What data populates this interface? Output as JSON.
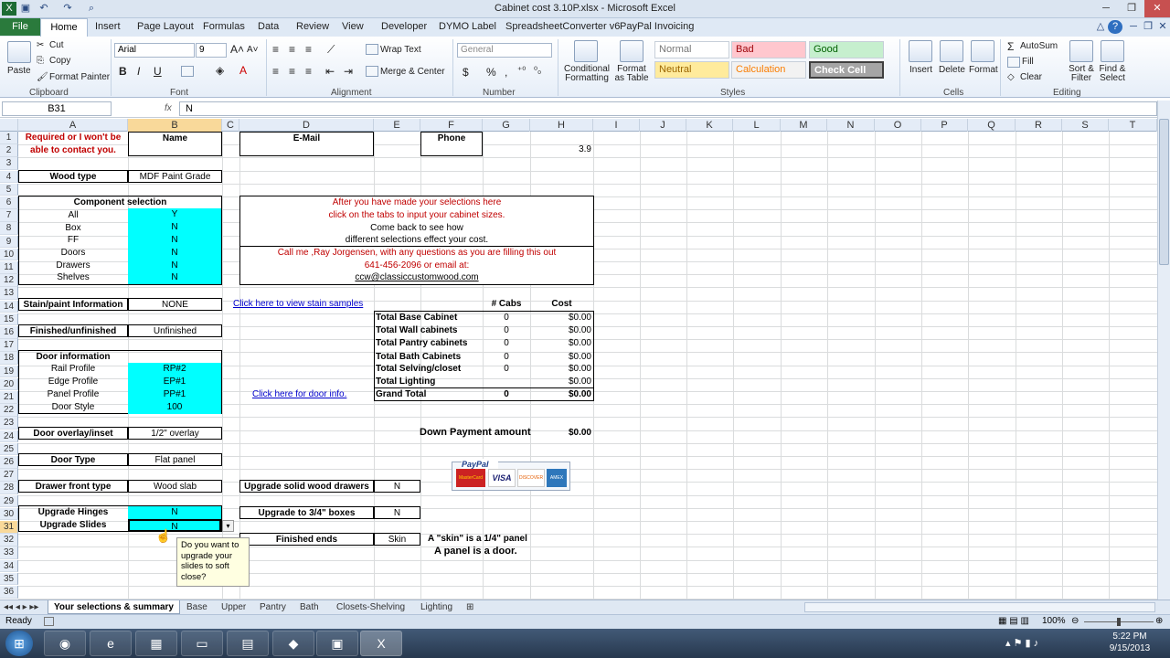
{
  "window": {
    "title": "Cabinet cost 3.10P.xlsx - Microsoft Excel"
  },
  "ribbon_tabs": [
    "File",
    "Home",
    "Insert",
    "Page Layout",
    "Formulas",
    "Data",
    "Review",
    "View",
    "Developer",
    "DYMO Label",
    "SpreadsheetConverter v6",
    "PayPal Invoicing"
  ],
  "clipboard": {
    "paste": "Paste",
    "cut": "Cut",
    "copy": "Copy",
    "format_painter": "Format Painter",
    "label": "Clipboard"
  },
  "font": {
    "name": "Arial",
    "size": "9",
    "label": "Font"
  },
  "alignment": {
    "wrap": "Wrap Text",
    "merge": "Merge & Center",
    "label": "Alignment"
  },
  "number": {
    "format": "General",
    "label": "Number",
    "currency": "$",
    "percent": "%",
    "comma": ","
  },
  "styles": {
    "conditional": "Conditional Formatting",
    "format_table": "Format as Table",
    "normal": "Normal",
    "bad": "Bad",
    "good": "Good",
    "neutral": "Neutral",
    "calculation": "Calculation",
    "check_cell": "Check Cell",
    "label": "Styles"
  },
  "cells_group": {
    "insert": "Insert",
    "delete": "Delete",
    "format": "Format",
    "label": "Cells"
  },
  "editing": {
    "autosum": "AutoSum",
    "fill": "Fill",
    "clear": "Clear",
    "sort": "Sort & Filter",
    "find": "Find & Select",
    "label": "Editing"
  },
  "formula_bar": {
    "name_box": "B31",
    "fx": "fx",
    "content": "N"
  },
  "columns": [
    "A",
    "B",
    "C",
    "D",
    "E",
    "F",
    "G",
    "H",
    "I",
    "J",
    "K",
    "L",
    "M",
    "N",
    "O",
    "P",
    "Q",
    "R",
    "S",
    "T"
  ],
  "rows": [
    "1",
    "2",
    "3",
    "4",
    "5",
    "6",
    "7",
    "8",
    "9",
    "10",
    "11",
    "12",
    "13",
    "14",
    "15",
    "16",
    "17",
    "18",
    "19",
    "20",
    "21",
    "22",
    "23",
    "24",
    "25",
    "26",
    "27",
    "28",
    "29",
    "30",
    "31",
    "32",
    "33",
    "34",
    "35",
    "36"
  ],
  "sheet": {
    "required_1": "Required or I won't be",
    "required_2": "able to contact you.",
    "name_hdr": "Name",
    "email_hdr": "E-Mail",
    "phone_hdr": "Phone",
    "h2": "3.9",
    "wood_type_lbl": "Wood type",
    "wood_type_val": "MDF Paint Grade",
    "component_hdr": "Component selection",
    "components": [
      {
        "label": "All",
        "val": "Y"
      },
      {
        "label": "Box",
        "val": "N"
      },
      {
        "label": "FF",
        "val": "N"
      },
      {
        "label": "Doors",
        "val": "N"
      },
      {
        "label": "Drawers",
        "val": "N"
      },
      {
        "label": "Shelves",
        "val": "N"
      }
    ],
    "info_1": "After you have made your selections here",
    "info_2": "click on the tabs to input your cabinet sizes.",
    "info_3": "Come back to see how",
    "info_4": "different selections effect your cost.",
    "call_1": "Call me ,Ray Jorgensen, with any questions as you are filling this out",
    "call_2": "641-456-2096 or email at:",
    "call_3": "ccw@classiccustomwood.com",
    "stain_lbl": "Stain/paint Information",
    "stain_val": "NONE",
    "stain_link": "Click here to view stain samples",
    "cabs_hdr": "# Cabs",
    "cost_hdr": "Cost",
    "totals": [
      {
        "label": "Total Base Cabinet",
        "cabs": "0",
        "cost": "$0.00"
      },
      {
        "label": "Total Wall cabinets",
        "cabs": "0",
        "cost": "$0.00"
      },
      {
        "label": "Total Pantry cabinets",
        "cabs": "0",
        "cost": "$0.00"
      },
      {
        "label": "Total Bath Cabinets",
        "cabs": "0",
        "cost": "$0.00"
      },
      {
        "label": "Total Selving/closet",
        "cabs": "0",
        "cost": "$0.00"
      },
      {
        "label": "Total Lighting",
        "cabs": "",
        "cost": "$0.00"
      }
    ],
    "grand_lbl": "Grand Total",
    "grand_cabs": "0",
    "grand_cost": "$0.00",
    "finished_lbl": "Finished/unfinished",
    "finished_val": "Unfinished",
    "door_info_hdr": "Door information",
    "door_info": [
      {
        "label": "Rail Profile",
        "val": "RP#2"
      },
      {
        "label": "Edge Profile",
        "val": "EP#1"
      },
      {
        "label": "Panel Profile",
        "val": "PP#1"
      },
      {
        "label": "Door Style",
        "val": "100"
      }
    ],
    "door_link": "Click here for door info.",
    "overlay_lbl": "Door overlay/inset",
    "overlay_val": "1/2\" overlay",
    "down_lbl": "Down Payment amount",
    "down_val": "$0.00",
    "door_type_lbl": "Door Type",
    "door_type_val": "Flat panel",
    "paypal": "PayPal",
    "mastercard": "MasterCard",
    "visa": "VISA",
    "discover": "DISCOVER",
    "amex": "AMEX",
    "drawer_front_lbl": "Drawer front type",
    "drawer_front_val": "Wood slab",
    "upgrade_drawers_lbl": "Upgrade solid wood drawers",
    "upgrade_drawers_val": "N",
    "hinges_lbl": "Upgrade Hinges",
    "hinges_val": "N",
    "boxes_lbl": "Upgrade to 3/4\" boxes",
    "boxes_val": "N",
    "slides_lbl": "Upgrade Slides",
    "slides_val": "N",
    "ends_lbl": "Finished ends",
    "ends_val": "Skin",
    "skin_note_1": "A \"skin\" is a 1/4\" panel",
    "skin_note_2": "A panel is a door.",
    "tooltip": "Do you want to upgrade your slides to soft close?"
  },
  "sheet_tabs": [
    "Your selections & summary",
    "Base",
    "Upper",
    "Pantry",
    "Bath",
    "Closets-Shelving",
    "Lighting"
  ],
  "status": {
    "ready": "Ready",
    "zoom": "100%"
  },
  "taskbar": {
    "time": "5:22 PM",
    "date": "9/15/2013"
  }
}
